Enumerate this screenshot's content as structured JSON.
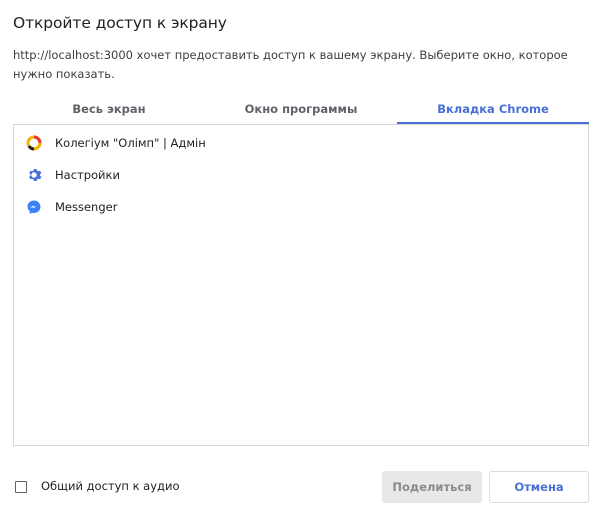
{
  "dialog": {
    "title": "Откройте доступ к экрану",
    "description": "http://localhost:3000 хочет предоставить доступ к вашему экрану. Выберите окно, которое нужно показать."
  },
  "tabs": [
    {
      "label": "Весь экран",
      "active": false
    },
    {
      "label": "Окно программы",
      "active": false
    },
    {
      "label": "Вкладка Chrome",
      "active": true
    }
  ],
  "list": {
    "items": [
      {
        "label": "Колегіум \"Олімп\" | Адмін",
        "icon": "olimp-logo-icon"
      },
      {
        "label": "Настройки",
        "icon": "gear-icon"
      },
      {
        "label": "Messenger",
        "icon": "messenger-icon"
      }
    ]
  },
  "footer": {
    "audio_label": "Общий доступ к аудио",
    "audio_checked": false,
    "share_label": "Поделиться",
    "cancel_label": "Отмена"
  },
  "colors": {
    "accent": "#4a6fd6",
    "messenger": "#3b82f6",
    "gear": "#4a6fd6"
  }
}
